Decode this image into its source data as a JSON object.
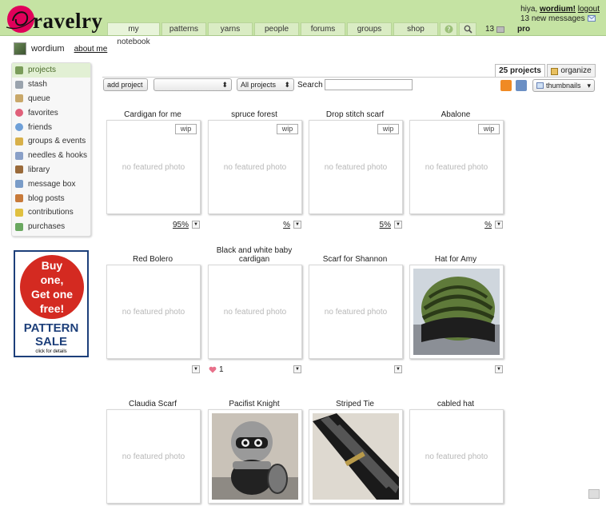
{
  "brand": "ravelry",
  "nav": [
    "my notebook",
    "patterns",
    "yarns",
    "people",
    "forums",
    "groups",
    "shop"
  ],
  "header": {
    "greeting": "hiya,",
    "username": "wordium!",
    "logout": "logout",
    "messages": "13 new messages",
    "message_count": "13",
    "pro": "pro"
  },
  "user": {
    "name": "wordium",
    "about": "about me"
  },
  "sidebar": [
    {
      "label": "projects",
      "color": "#7a9c5a"
    },
    {
      "label": "stash",
      "color": "#9aa3ad"
    },
    {
      "label": "queue",
      "color": "#c9a86a"
    },
    {
      "label": "favorites",
      "color": "#e0607a"
    },
    {
      "label": "friends",
      "color": "#6fa0d8"
    },
    {
      "label": "groups & events",
      "color": "#d8b04a"
    },
    {
      "label": "needles & hooks",
      "color": "#8aa0c8"
    },
    {
      "label": "library",
      "color": "#9a6a3a"
    },
    {
      "label": "message box",
      "color": "#7a9cc8"
    },
    {
      "label": "blog posts",
      "color": "#c87a3a"
    },
    {
      "label": "contributions",
      "color": "#e0c040"
    },
    {
      "label": "purchases",
      "color": "#6aa860"
    }
  ],
  "ad": {
    "line1": "Buy",
    "line2": "one,",
    "line3": "Get one",
    "line4": "free!",
    "sale1": "PATTERN",
    "sale2": "SALE",
    "details": "click for details"
  },
  "tabs": {
    "projects": "25 projects",
    "organize": "organize"
  },
  "toolbar": {
    "add_project": "add project",
    "filter": "All projects",
    "search_label": "Search",
    "view": "thumbnails"
  },
  "projects": [
    {
      "title": "Cardigan for me",
      "status": "wip",
      "photo": "no featured photo",
      "progress": "95%"
    },
    {
      "title": "spruce forest",
      "status": "wip",
      "photo": "no featured photo",
      "progress": "%"
    },
    {
      "title": "Drop stitch scarf",
      "status": "wip",
      "photo": "no featured photo",
      "progress": "5%"
    },
    {
      "title": "Abalone",
      "status": "wip",
      "photo": "no featured photo",
      "progress": "%"
    },
    {
      "title": "Red Bolero",
      "photo": "no featured photo"
    },
    {
      "title": "Black and white baby cardigan",
      "photo": "no featured photo",
      "favorites": "1"
    },
    {
      "title": "Scarf for Shannon",
      "photo": "no featured photo"
    },
    {
      "title": "Hat for Amy",
      "image": "green-black-crochet-hat"
    },
    {
      "title": "Claudia Scarf",
      "photo": "no featured photo"
    },
    {
      "title": "Pacifist Knight",
      "image": "grey-knight-amigurumi"
    },
    {
      "title": "Striped Tie",
      "image": "black-grey-striped-tie"
    },
    {
      "title": "cabled hat",
      "photo": "no featured photo"
    }
  ]
}
